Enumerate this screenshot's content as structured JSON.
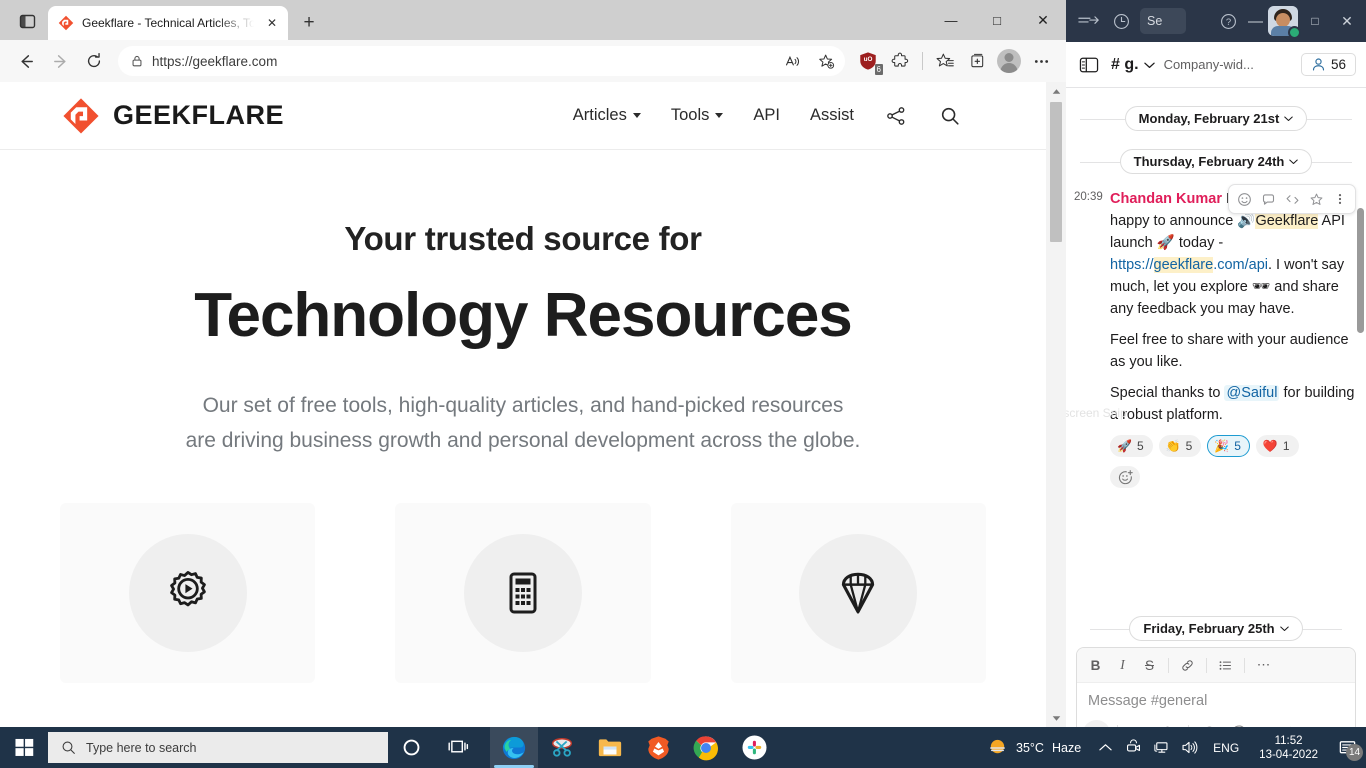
{
  "browser": {
    "tab": {
      "title": "Geekflare - Technical Articles, Too",
      "favicon_name": "geekflare-favicon",
      "close_label": "✕"
    },
    "new_tab_label": "+",
    "tab_strip_icon": "tab-actions-icon",
    "nav": {
      "back": "back-arrow-icon",
      "forward": "forward-arrow-icon",
      "reload": "reload-icon"
    },
    "address": {
      "url": "https://geekflare.com",
      "lock_icon": "lock-icon",
      "read_aloud_icon": "read-aloud-icon",
      "add_favorite_icon": "add-favorite-star-icon"
    },
    "toolbar": {
      "ublock_badge": "6",
      "ublock_name": "ublock-origin-icon",
      "extensions_name": "extensions-puzzle-icon",
      "favorites_name": "favorites-icon",
      "collections_name": "collections-icon",
      "profile_name": "profile-avatar",
      "settings_name": "settings-more-icon"
    },
    "window_controls": {
      "minimize": "—",
      "maximize": "□",
      "close": "✕"
    }
  },
  "site": {
    "brand": "GEEKFLARE",
    "nav": [
      {
        "label": "Articles",
        "has_caret": true
      },
      {
        "label": "Tools",
        "has_caret": true
      },
      {
        "label": "API",
        "has_caret": false
      },
      {
        "label": "Assist",
        "has_caret": false
      }
    ],
    "nav_icons": [
      {
        "name": "share-icon"
      },
      {
        "name": "search-icon"
      }
    ],
    "hero": {
      "kicker": "Your trusted source for",
      "title": "Technology Resources",
      "subtitle_line1": "Our set of free tools, high-quality articles, and hand-picked resources",
      "subtitle_line2": "are driving business growth and personal development across the globe."
    },
    "cards": [
      {
        "icon": "gear-play-icon"
      },
      {
        "icon": "calculator-icon"
      },
      {
        "icon": "diamond-gem-icon"
      }
    ]
  },
  "slack": {
    "titlebar": {
      "history_icon": "history-clock-icon",
      "forward_icon": "forward-arrow-icon",
      "search_value": "Se",
      "help_icon": "help-question-icon",
      "minimize": "—",
      "maximize": "□",
      "close": "✕",
      "avatar_name": "user-avatar",
      "presence": "online"
    },
    "channel": {
      "toggle_icon": "sidebar-toggle-icon",
      "name": "# g.",
      "topic": "Company-wid...",
      "member_count": "56",
      "member_icon": "person-icon"
    },
    "dividers": {
      "first": "Monday, February 21st",
      "second": "Thursday, February 24th",
      "third": "Friday, February 25th"
    },
    "hover_toolbar": [
      {
        "name": "emoji-reaction-icon"
      },
      {
        "name": "thread-reply-icon"
      },
      {
        "name": "share-message-icon"
      },
      {
        "name": "bookmark-icon"
      },
      {
        "name": "more-actions-icon"
      }
    ],
    "message": {
      "time": "20:39",
      "author": "Chandan Kumar",
      "part1_a": "Hello lovely people, happy to announce ",
      "emoji_speaker": "🔊",
      "highlight1": "Geekflare",
      "part1_b": " API launch ",
      "emoji_rocket": "🚀",
      "part1_c": " today - ",
      "link_pre": "https://",
      "link_highlight": "geekflare",
      "link_post": ".com/api",
      "part1_d": ". I won't say much, let you explore ",
      "emoji_glasses": "🕶",
      "part1_e": " and share any feedback you may have.",
      "part2": "Feel free to share with your audience as you like.",
      "part3_a": "Special thanks to ",
      "mention": "@Saiful",
      "part3_b": " for building a robust platform.",
      "reactions": [
        {
          "emoji": "🚀",
          "count": "5",
          "selected": false
        },
        {
          "emoji": "👏",
          "count": "5",
          "selected": false
        },
        {
          "emoji": "🎉",
          "count": "5",
          "selected": true
        },
        {
          "emoji": "❤️",
          "count": "1",
          "selected": false
        }
      ],
      "add_reaction_icon": "add-reaction-icon"
    },
    "ghost_tooltip": "Full-screen Snip",
    "composer": {
      "format_buttons": [
        {
          "name": "bold-button",
          "label": "B"
        },
        {
          "name": "italic-button",
          "label": "I"
        },
        {
          "name": "strikethrough-button",
          "label": "S"
        },
        {
          "name": "link-button",
          "label": "link-icon"
        },
        {
          "name": "bulleted-list-button",
          "label": "list-icon"
        },
        {
          "name": "more-format-button",
          "label": "⋯"
        }
      ],
      "placeholder": "Message #general",
      "actions": [
        {
          "name": "attach-button",
          "label": "+"
        },
        {
          "name": "video-clip-button",
          "label": "video-icon"
        },
        {
          "name": "audio-clip-button",
          "label": "microphone-icon"
        },
        {
          "name": "emoji-button",
          "label": "emoji-icon"
        },
        {
          "name": "mention-button",
          "label": "@"
        },
        {
          "name": "formatting-button",
          "label": "Aa"
        },
        {
          "name": "send-button",
          "label": "send-icon"
        }
      ]
    }
  },
  "taskbar": {
    "start_icon": "windows-start-icon",
    "search_placeholder": "Type here to search",
    "search_icon": "search-icon",
    "cortana_icon": "cortana-circle-icon",
    "task_view_icon": "task-view-icon",
    "apps": [
      {
        "name": "taskbar-app-edge",
        "active": true
      },
      {
        "name": "taskbar-app-snipping-tool",
        "active": false
      },
      {
        "name": "taskbar-app-file-explorer",
        "active": false
      },
      {
        "name": "taskbar-app-brave",
        "active": false
      },
      {
        "name": "taskbar-app-chrome",
        "active": false
      },
      {
        "name": "taskbar-app-slack",
        "active": false
      }
    ],
    "tray": {
      "weather_temp": "35°C",
      "weather_desc": "Haze",
      "weather_icon": "haze-sun-icon",
      "show_hidden_icon": "chevron-up-icon",
      "camera_icon": "camera-icon",
      "network_icon": "network-icon",
      "volume_icon": "volume-icon",
      "language": "ENG",
      "time": "11:52",
      "date": "13-04-2022",
      "notification_icon": "notifications-icon",
      "notification_count": "14"
    }
  },
  "colors": {
    "brand_orange": "#f1502f",
    "slack_titlebar": "#2b3648",
    "taskbar": "#1f3348",
    "author_red": "#e01e5a",
    "link_blue": "#1264a3",
    "highlight_yellow": "#fdf0c8"
  }
}
